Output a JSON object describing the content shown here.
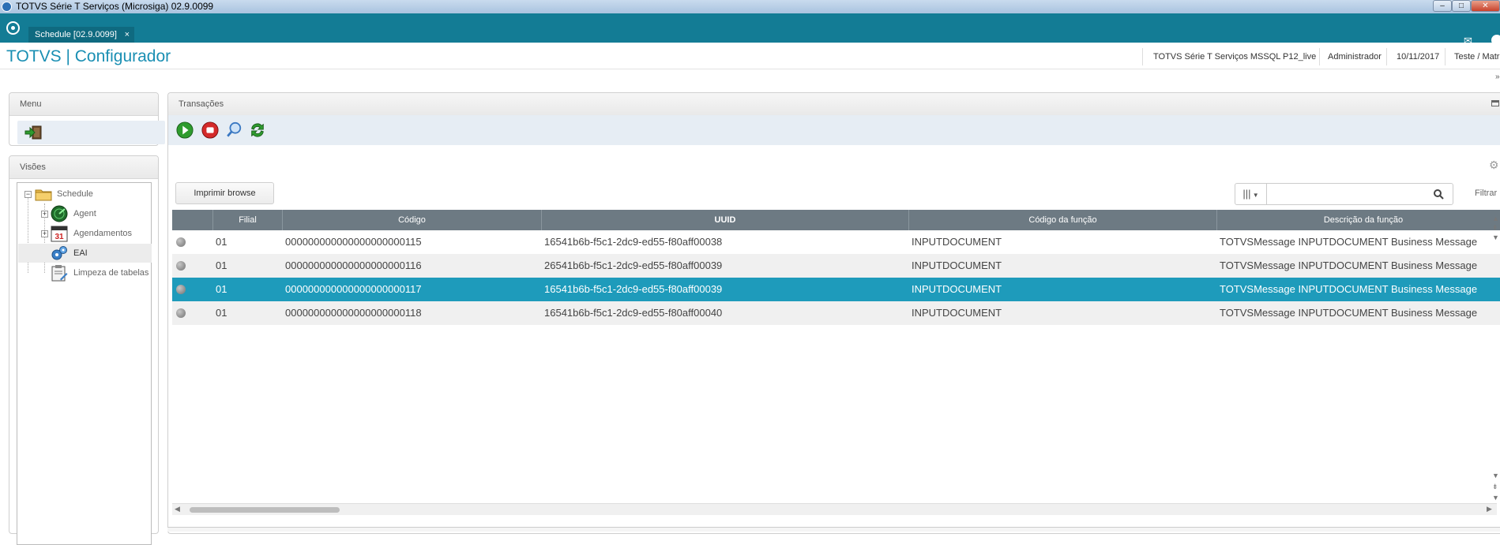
{
  "window": {
    "title": "TOTVS Série T Serviços (Microsiga) 02.9.0099"
  },
  "tabbar": {
    "tab_label": "Schedule [02.9.0099]",
    "tab_close": "×"
  },
  "header": {
    "app_title": "TOTVS | Configurador",
    "environment": "TOTVS Série T Serviços MSSQL P12_live",
    "user": "Administrador",
    "date": "10/11/2017",
    "company": "Teste / Matriz"
  },
  "menu_panel": {
    "title": "Menu"
  },
  "visoes_panel": {
    "title": "Visões",
    "tree": [
      {
        "label": "Schedule",
        "icon": "folder-icon",
        "level": 0,
        "expander": "−"
      },
      {
        "label": "Agent",
        "icon": "radar-icon",
        "level": 1,
        "expander": "+"
      },
      {
        "label": "Agendamentos",
        "icon": "calendar-icon",
        "level": 1,
        "expander": "+"
      },
      {
        "label": "EAI",
        "icon": "gears-icon",
        "level": 1,
        "expander": ""
      },
      {
        "label": "Limpeza de tabelas",
        "icon": "clipboard-icon",
        "level": 1,
        "expander": ""
      }
    ],
    "selected": "EAI"
  },
  "transacoes_panel": {
    "title": "Transações",
    "toolbar": [
      {
        "name": "start",
        "icon": "play-icon",
        "color": "#2e9b2e"
      },
      {
        "name": "stop",
        "icon": "stop-icon",
        "color": "#d42a2a"
      },
      {
        "name": "search",
        "icon": "magnifier-icon",
        "color": "#3a78c2"
      },
      {
        "name": "refresh",
        "icon": "refresh-icon",
        "color": "#2e9b2e"
      }
    ],
    "print_button": "Imprimir browse",
    "search": {
      "placeholder": "",
      "value": ""
    },
    "filter_label": "Filtrar"
  },
  "grid": {
    "columns": [
      "",
      "Filial",
      "Código",
      "UUID",
      "Código da função",
      "Descrição da função"
    ],
    "rows": [
      {
        "filial": "01",
        "codigo": "000000000000000000000115",
        "uuid": "16541b6b-f5c1-2dc9-ed55-f80aff00038",
        "cod_funcao": "INPUTDOCUMENT",
        "descricao": "TOTVSMessage INPUTDOCUMENT Business Message"
      },
      {
        "filial": "01",
        "codigo": "000000000000000000000116",
        "uuid": "26541b6b-f5c1-2dc9-ed55-f80aff00039",
        "cod_funcao": "INPUTDOCUMENT",
        "descricao": "TOTVSMessage INPUTDOCUMENT Business Message"
      },
      {
        "filial": "01",
        "codigo": "000000000000000000000117",
        "uuid": "16541b6b-f5c1-2dc9-ed55-f80aff00039",
        "cod_funcao": "INPUTDOCUMENT",
        "descricao": "TOTVSMessage INPUTDOCUMENT Business Message"
      },
      {
        "filial": "01",
        "codigo": "000000000000000000000118",
        "uuid": "16541b6b-f5c1-2dc9-ed55-f80aff00040",
        "cod_funcao": "INPUTDOCUMENT",
        "descricao": "TOTVSMessage INPUTDOCUMENT Business Message"
      }
    ],
    "selected_row": 2
  },
  "colors": {
    "accent": "#137c95",
    "selection": "#1e9bbb",
    "grid_header": "#6d7a83",
    "title_blue": "#1a8fb3"
  }
}
